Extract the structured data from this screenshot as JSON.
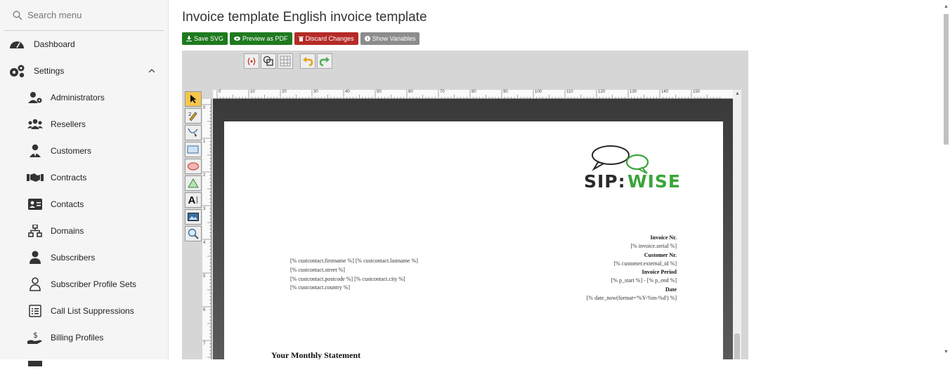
{
  "sidebar": {
    "search_placeholder": "Search menu",
    "items": [
      {
        "label": "Dashboard",
        "icon": "gauge-icon"
      },
      {
        "label": "Settings",
        "icon": "gears-icon"
      },
      {
        "label": "Administrators",
        "icon": "admin-icon"
      },
      {
        "label": "Resellers",
        "icon": "users-icon"
      },
      {
        "label": "Customers",
        "icon": "customer-icon"
      },
      {
        "label": "Contracts",
        "icon": "handshake-icon"
      },
      {
        "label": "Contacts",
        "icon": "contact-card-icon"
      },
      {
        "label": "Domains",
        "icon": "sitemap-icon"
      },
      {
        "label": "Subscribers",
        "icon": "person-icon"
      },
      {
        "label": "Subscriber Profile Sets",
        "icon": "person-outline-icon"
      },
      {
        "label": "Call List Suppressions",
        "icon": "list-icon"
      },
      {
        "label": "Billing Profiles",
        "icon": "money-hand-icon"
      }
    ]
  },
  "main": {
    "title": "Invoice template English invoice template",
    "buttons": {
      "save": "Save SVG",
      "preview": "Preview as PDF",
      "discard": "Discard Changes",
      "variables": "Show Variables"
    }
  },
  "ruler": {
    "h_labels": [
      "0",
      "10",
      "20",
      "30",
      "40",
      "50",
      "60",
      "70",
      "80",
      "90",
      "100",
      "110",
      "120",
      "130",
      "140",
      "150"
    ],
    "v_labels": [
      "0",
      "1",
      "2",
      "3",
      "4",
      "5",
      "6",
      "7"
    ]
  },
  "doc": {
    "logo_text": "SIP:WISE",
    "address": [
      "[% custcontact.firstname %] [% custcontact.lastname %]",
      "[% custcontact.street %]",
      "[% custcontact.postcode %] [% custcontact.city %]",
      "[% custcontact.country %]"
    ],
    "invoice_nr_label": "Invoice Nr.",
    "invoice_nr_value": "[% invoice.serial %]",
    "customer_nr_label": "Customer Nr.",
    "customer_nr_value": "[% customer.external_id %]",
    "period_label": "Invoice Period",
    "period_value": "[% p_start %] - [% p_end %]",
    "date_label": "Date",
    "date_value": "[% date_now(format='%Y-%m-%d') %]",
    "statement_heading": "Your Monthly Statement"
  },
  "colors": {
    "save": "#1f7a1f",
    "discard": "#b52b27",
    "variables": "#8c8c8c",
    "logo_accent": "#3aa53a"
  }
}
